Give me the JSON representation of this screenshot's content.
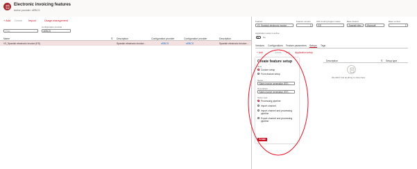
{
  "header": {
    "title": "Electronic invoicing features",
    "subtitle": "Active provider: eEBCS"
  },
  "toolbar": {
    "new_label": "+ Add",
    "delete_label": "Delete",
    "import_label": "Import",
    "usage_label": "Usage management"
  },
  "filter": {
    "placeholder": "Filter",
    "provider_label": "Configuration provider",
    "provider_value": "eEBCS"
  },
  "grid": {
    "columns": [
      "Name",
      "Description",
      "Configuration provider",
      "Configuration provider",
      "Description"
    ],
    "rows": [
      {
        "name": "V3_Spanish electronic invoice (ES)",
        "description": "Spanish electronic invoice...",
        "provider1": "eEBCS",
        "provider2": "eEBCS",
        "description2": "Spanish electronic invoice..."
      }
    ]
  },
  "right_panel": {
    "feature_label": "Feature",
    "feature_value": "V3_Spanish electronic invoice...",
    "feature_version_label": "Feature version",
    "feature_version_value": "3",
    "iso_label": "ISO Country/region codes",
    "iso_value": "ES",
    "base_feature_label": "Base feature",
    "base_feature_value": "Spanish elec...",
    "base_feature_provider": "Microsoft",
    "base_version_label": "Base version",
    "base_version_value": "2",
    "setup_active_label": "Application setup is active",
    "toggle_text": "No",
    "tabs": [
      "Versions",
      "Configurations",
      "Feature parameters",
      "Setups",
      "Tags"
    ],
    "active_tab": "Setups",
    "sub_toolbar": {
      "new_label": "+ Add",
      "delete_label": "Delete",
      "edit_label": "Edit",
      "app_setup_label": "Application setup"
    },
    "columns": [
      "Description",
      "Setup type"
    ],
    "empty_text": "We didn't find anything to show here."
  },
  "panel": {
    "title": "Create feature setup",
    "new_label": "New",
    "new_options": [
      "Custom setup",
      "From feature setup"
    ],
    "name_label": "Name",
    "name_value": "Sales invoice generation (ES) ...",
    "description_label": "Description",
    "description_value": "Sales invoice generation (ES) ...",
    "setup_type_label": "Setup type",
    "setup_types": [
      "Processing pipeline",
      "Import channel",
      "Import channel and processing pipeline",
      "Export channel and processing pipeline"
    ],
    "create_label": "Create"
  },
  "colors": {
    "accent": "#c50f1f",
    "annotation": "#e81123",
    "selected_row": "#f3e0e0",
    "link": "#0f6cbd"
  }
}
